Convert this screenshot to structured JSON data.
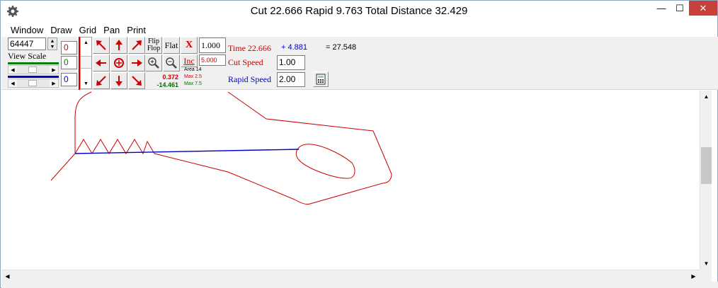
{
  "window": {
    "title": "Cut 22.666  Rapid 9.763  Total Distance 32.429",
    "app_icon": "gear-icon",
    "minimize_glyph": "—",
    "maximize_glyph": "☐",
    "close_glyph": "✕"
  },
  "menu": {
    "items": [
      "Window",
      "Draw",
      "Grid",
      "Pan",
      "Print"
    ]
  },
  "toolbar": {
    "scale_value": "64447",
    "view_scale_label": "View Scale",
    "color_boxes": [
      "0",
      "0",
      "0"
    ],
    "flip_label_top": "Flip",
    "flip_label_bottom": "Flop",
    "flat_label": "Flat",
    "x_label": "X",
    "inc_label": "Inc",
    "step_value": "1.000",
    "inc_value": "5.000",
    "coord_x": "0.372",
    "coord_y": "-14.461",
    "area_label": "Area 14",
    "max_x_label": "Max 2.5",
    "max_y_label": "Max 7.5",
    "time_label": "Time 22.666",
    "rapid_time": "+ 4.881",
    "total_time": "= 27.548",
    "cut_speed_label": "Cut Speed",
    "cut_speed_value": "1.00",
    "rapid_speed_label": "Rapid Speed",
    "rapid_speed_value": "2.00"
  },
  "colors": {
    "cut_path": "#cc0000",
    "rapid_path": "#0000cc",
    "coord_x": "#cc0000",
    "coord_y": "#007000"
  }
}
